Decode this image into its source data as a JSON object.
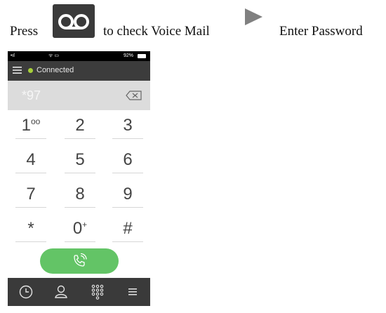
{
  "instruction": {
    "press": "Press",
    "check": "to check Voice Mail",
    "enter": "Enter Password"
  },
  "icons": {
    "voicemail": "voicemail-icon",
    "arrow": "play-arrow-icon",
    "menu": "hamburger-menu-icon",
    "backspace": "backspace-icon",
    "call": "phone-call-icon",
    "tabs": [
      "clock-icon",
      "contact-icon",
      "dialpad-icon",
      "list-icon"
    ]
  },
  "phone": {
    "statusbar": {
      "signal": "•ıl",
      "center": "ᯤ ▭",
      "battery": "92%"
    },
    "appbar": {
      "status": "Connected"
    },
    "entry": {
      "number": "*97"
    },
    "keys": [
      {
        "main": "1",
        "sub": "ᴏᴏ"
      },
      {
        "main": "2",
        "sub": ""
      },
      {
        "main": "3",
        "sub": ""
      },
      {
        "main": "4",
        "sub": ""
      },
      {
        "main": "5",
        "sub": ""
      },
      {
        "main": "6",
        "sub": ""
      },
      {
        "main": "7",
        "sub": ""
      },
      {
        "main": "8",
        "sub": ""
      },
      {
        "main": "9",
        "sub": ""
      },
      {
        "main": "*",
        "sub": ""
      },
      {
        "main": "0",
        "sub": "+"
      },
      {
        "main": "#",
        "sub": ""
      }
    ]
  },
  "colors": {
    "connected_dot": "#a6cf3a",
    "call_button": "#63c466",
    "appbar": "#3c3c3c",
    "tabbar": "#3a3a3a"
  }
}
